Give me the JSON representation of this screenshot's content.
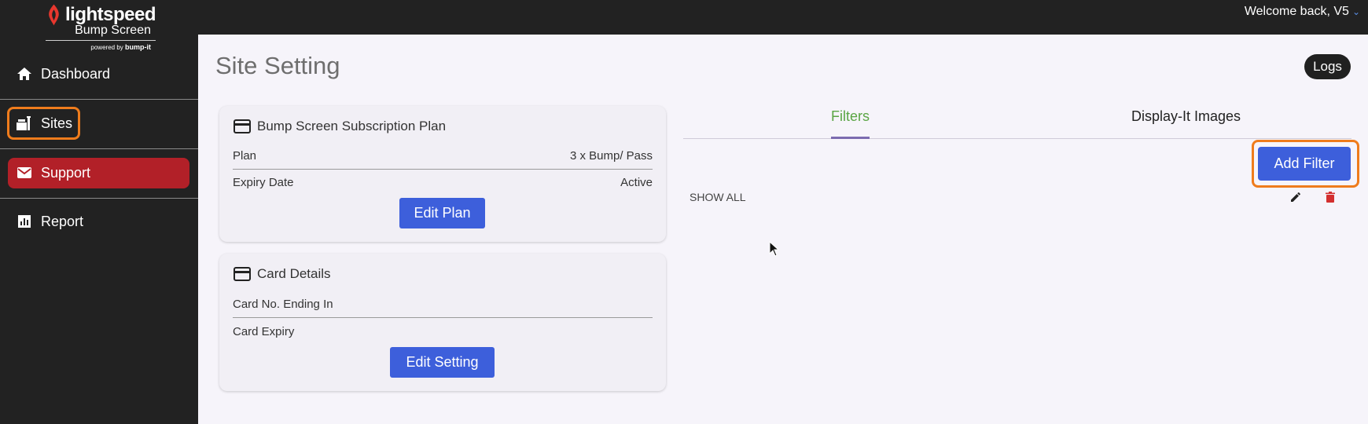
{
  "header": {
    "welcome": "Welcome back, V5"
  },
  "brand": {
    "name": "lightspeed",
    "product": "Bump Screen",
    "powered_prefix": "powered by",
    "powered_name": "bump-it"
  },
  "sidebar": {
    "items": [
      {
        "label": "Dashboard",
        "icon": "home-icon"
      },
      {
        "label": "Sites",
        "icon": "sites-icon"
      },
      {
        "label": "Support",
        "icon": "mail-icon"
      },
      {
        "label": "Report",
        "icon": "report-icon"
      }
    ]
  },
  "page": {
    "title": "Site Setting",
    "logs_label": "Logs"
  },
  "subscription_card": {
    "title": "Bump Screen Subscription Plan",
    "rows": [
      {
        "label": "Plan",
        "value": "3 x Bump/ Pass"
      },
      {
        "label": "Expiry Date",
        "value": "Active"
      }
    ],
    "button": "Edit Plan"
  },
  "card_details": {
    "title": "Card Details",
    "rows": [
      {
        "label": "Card No. Ending In",
        "value": ""
      },
      {
        "label": "Card Expiry",
        "value": ""
      }
    ],
    "button": "Edit Setting"
  },
  "tabs": [
    {
      "label": "Filters",
      "active": true
    },
    {
      "label": "Display-It Images",
      "active": false
    }
  ],
  "filters": {
    "add_label": "Add Filter",
    "items": [
      {
        "name": "SHOW ALL"
      }
    ]
  },
  "colors": {
    "accent_blue": "#3d5fdb",
    "support_red": "#b22028",
    "highlight_orange": "#ef7c1c",
    "active_tab_green": "#5aa544",
    "delete_red": "#d32f2f"
  }
}
